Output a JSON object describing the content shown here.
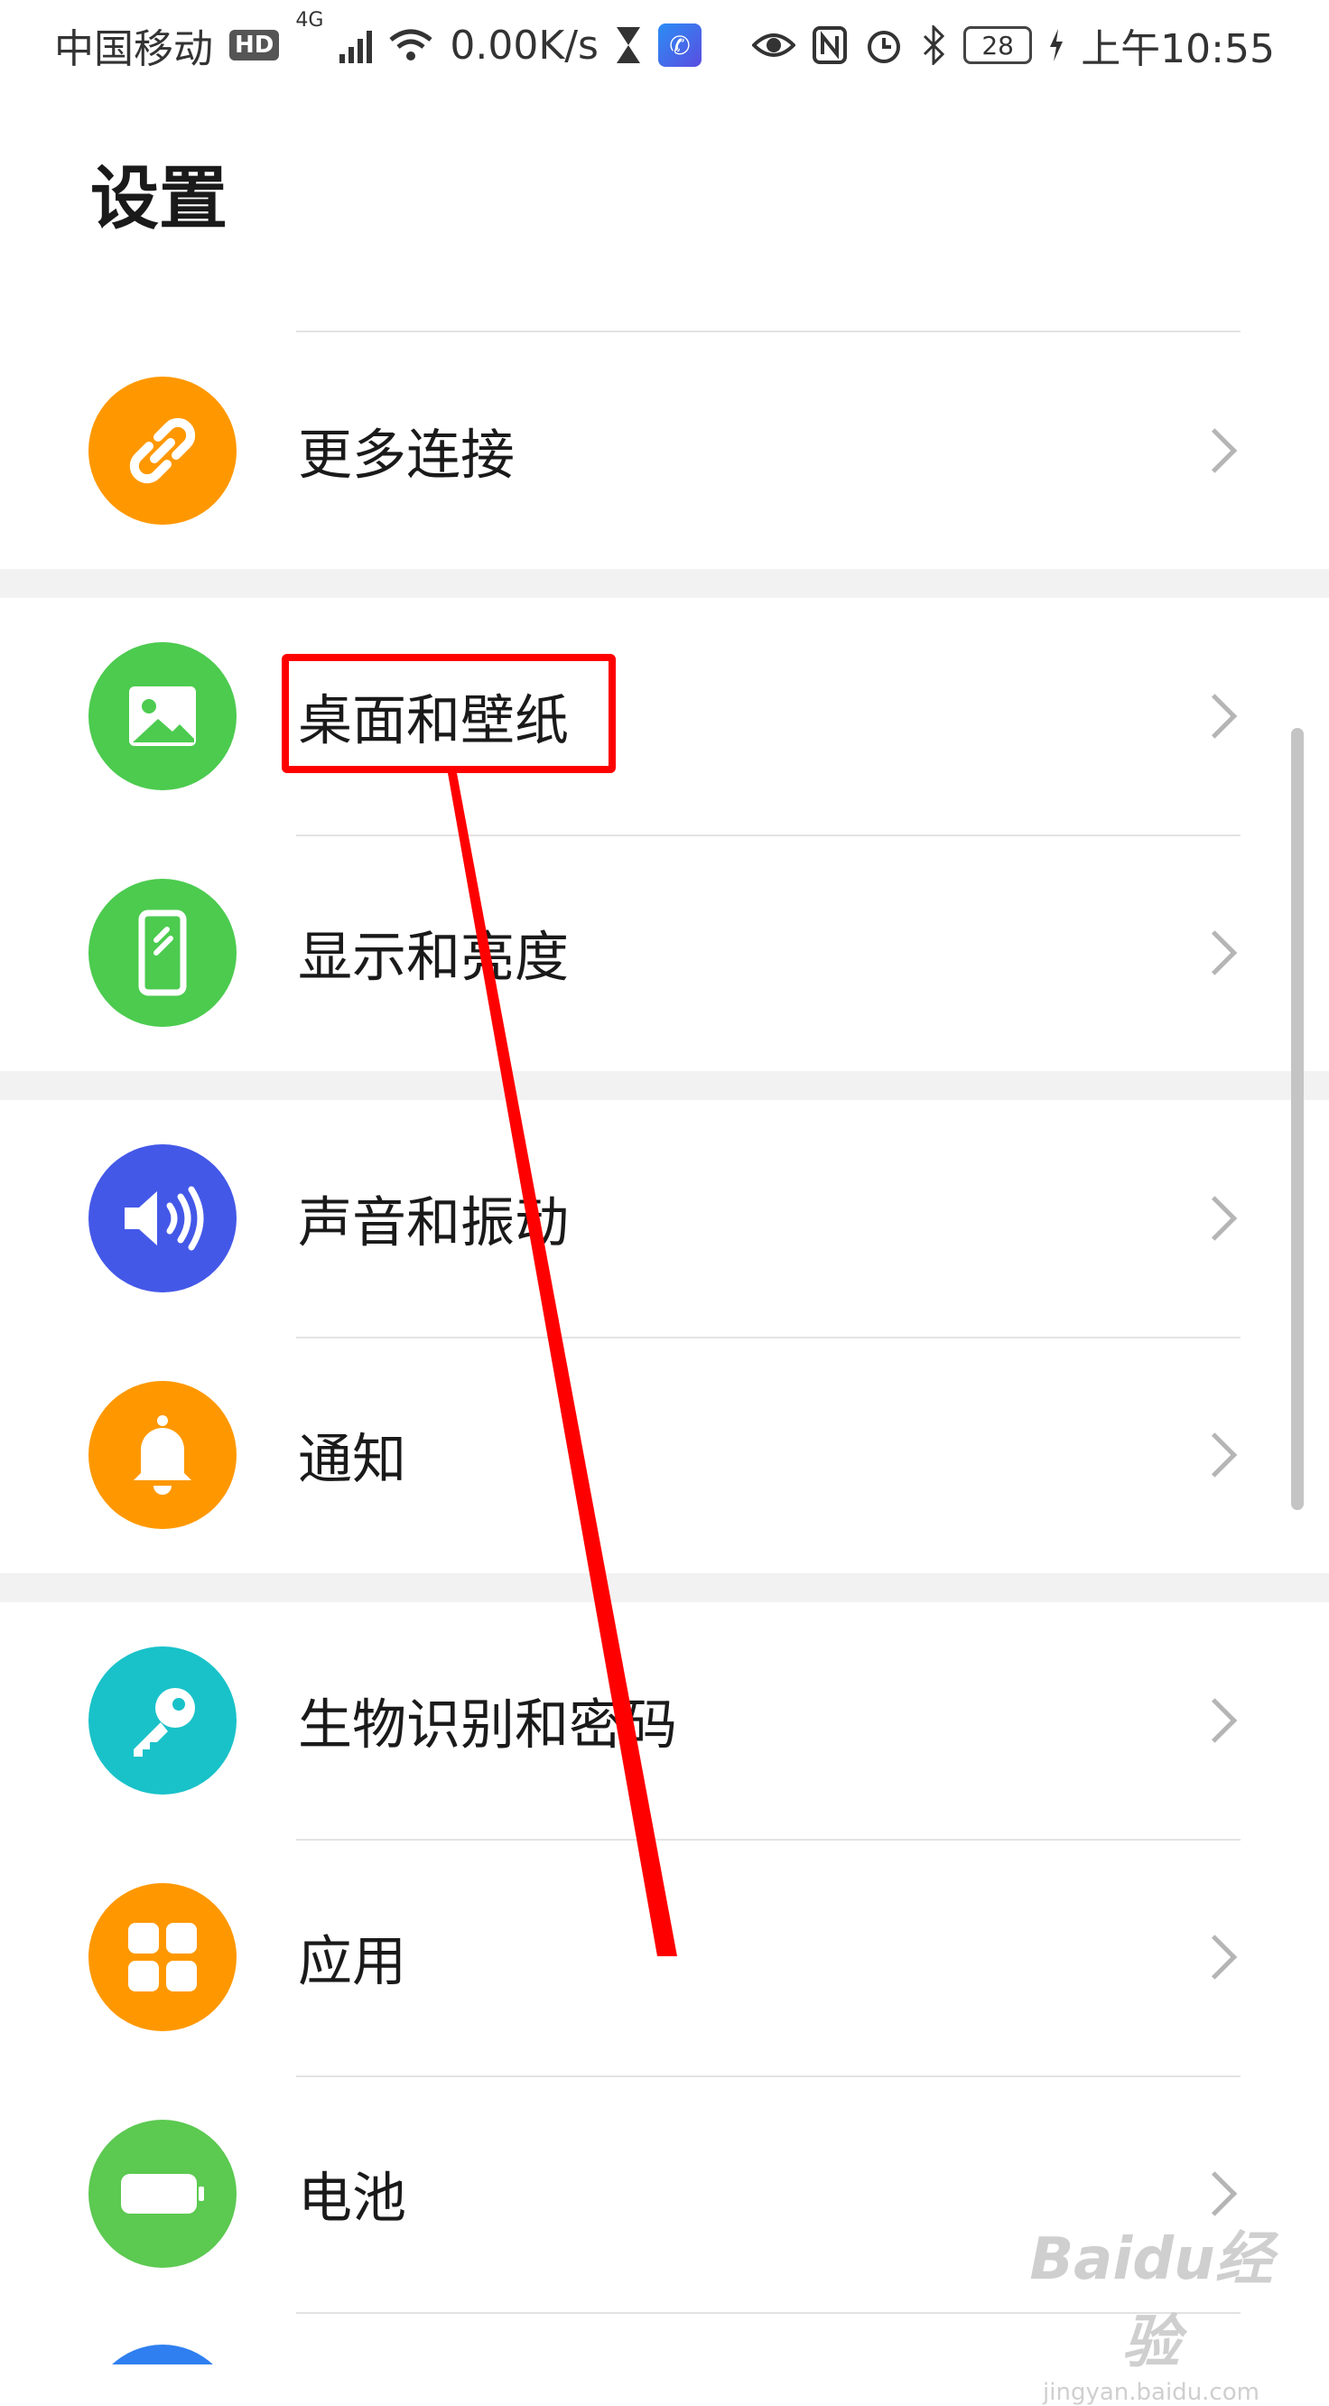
{
  "status_bar": {
    "carrier": "中国移动",
    "hd": "HD",
    "network": "4G",
    "speed": "0.00K/s",
    "battery": "28",
    "time": "上午10:55"
  },
  "page": {
    "title": "设置"
  },
  "settings": {
    "items": [
      {
        "label": "更多连接",
        "icon": "link-icon",
        "color": "#FF9800"
      },
      {
        "label": "桌面和壁纸",
        "icon": "image-icon",
        "color": "#4CCB4F"
      },
      {
        "label": "显示和亮度",
        "icon": "phone-brightness-icon",
        "color": "#4CCB4F"
      },
      {
        "label": "声音和振动",
        "icon": "speaker-icon",
        "color": "#4458E8"
      },
      {
        "label": "通知",
        "icon": "bell-icon",
        "color": "#FF9800"
      },
      {
        "label": "生物识别和密码",
        "icon": "key-icon",
        "color": "#19C2C9"
      },
      {
        "label": "应用",
        "icon": "apps-grid-icon",
        "color": "#FF9800"
      },
      {
        "label": "电池",
        "icon": "battery-icon",
        "color": "#5CC951"
      }
    ]
  },
  "annotation": {
    "color": "#FF0000"
  },
  "watermark": {
    "logo": "Baidu经验",
    "url": "jingyan.baidu.com"
  }
}
